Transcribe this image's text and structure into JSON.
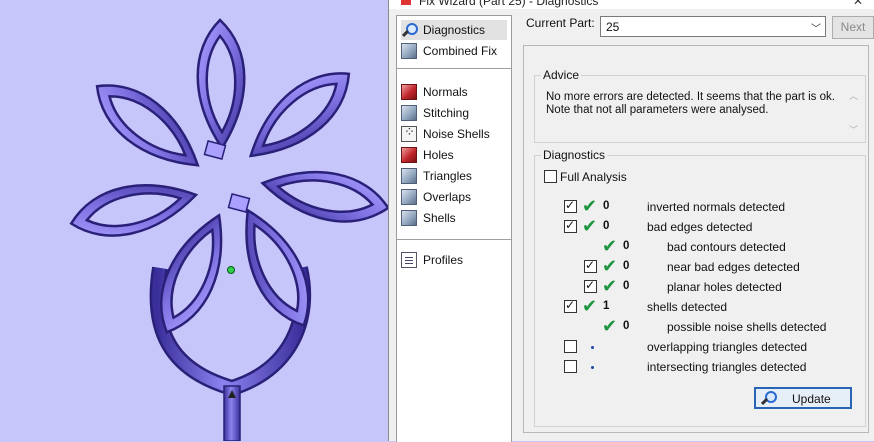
{
  "window": {
    "title": "Fix Wizard (Part 25) - Diagnostics",
    "close": "✕"
  },
  "nav": {
    "top_items": [
      {
        "label": "Diagnostics",
        "icon": "magnifier-icon",
        "selected": true
      },
      {
        "label": "Combined Fix",
        "icon": "cube-icon"
      }
    ],
    "fix_items": [
      {
        "label": "Normals",
        "icon": "normals-cube-icon"
      },
      {
        "label": "Stitching",
        "icon": "stitching-cube-icon"
      },
      {
        "label": "Noise Shells",
        "icon": "dice-icon"
      },
      {
        "label": "Holes",
        "icon": "holes-cube-icon"
      },
      {
        "label": "Triangles",
        "icon": "triangles-cube-icon"
      },
      {
        "label": "Overlaps",
        "icon": "overlaps-cube-icon"
      },
      {
        "label": "Shells",
        "icon": "shells-cube-icon"
      }
    ],
    "bottom_items": [
      {
        "label": "Profiles",
        "icon": "document-icon"
      }
    ]
  },
  "current_part": {
    "label": "Current Part:",
    "value": "25"
  },
  "next_label": "Next",
  "advice": {
    "legend": "Advice",
    "text": "No more errors are detected. It seems that the part is ok. Note that not all parameters were analysed."
  },
  "diagnostics": {
    "legend": "Diagnostics",
    "full_analysis_label": "Full Analysis",
    "rows": [
      {
        "checked": true,
        "status": "ok",
        "count": "0",
        "label": "inverted normals detected"
      },
      {
        "checked": true,
        "status": "ok",
        "count": "0",
        "label": "bad edges detected"
      },
      {
        "checked": null,
        "status": "ok",
        "count": "0",
        "label": "bad contours detected"
      },
      {
        "checked": true,
        "status": "ok",
        "count": "0",
        "label": "near bad edges detected"
      },
      {
        "checked": true,
        "status": "ok",
        "count": "0",
        "label": "planar holes detected"
      },
      {
        "checked": true,
        "status": "ok",
        "count": "1",
        "label": "shells detected"
      },
      {
        "checked": null,
        "status": "ok",
        "count": "0",
        "label": "possible noise shells detected"
      },
      {
        "checked": false,
        "status": "not-run",
        "count": "",
        "label": "overlapping triangles detected"
      },
      {
        "checked": false,
        "status": "not-run",
        "count": "",
        "label": "intersecting triangles detected"
      }
    ]
  },
  "update_label": "Update",
  "colors": {
    "viewport_bg": "#c6c6fa",
    "model": "#7b6fe0",
    "model_dark": "#3a2f9a",
    "ok_green": "#1e9540",
    "accent": "#2a64b4"
  }
}
